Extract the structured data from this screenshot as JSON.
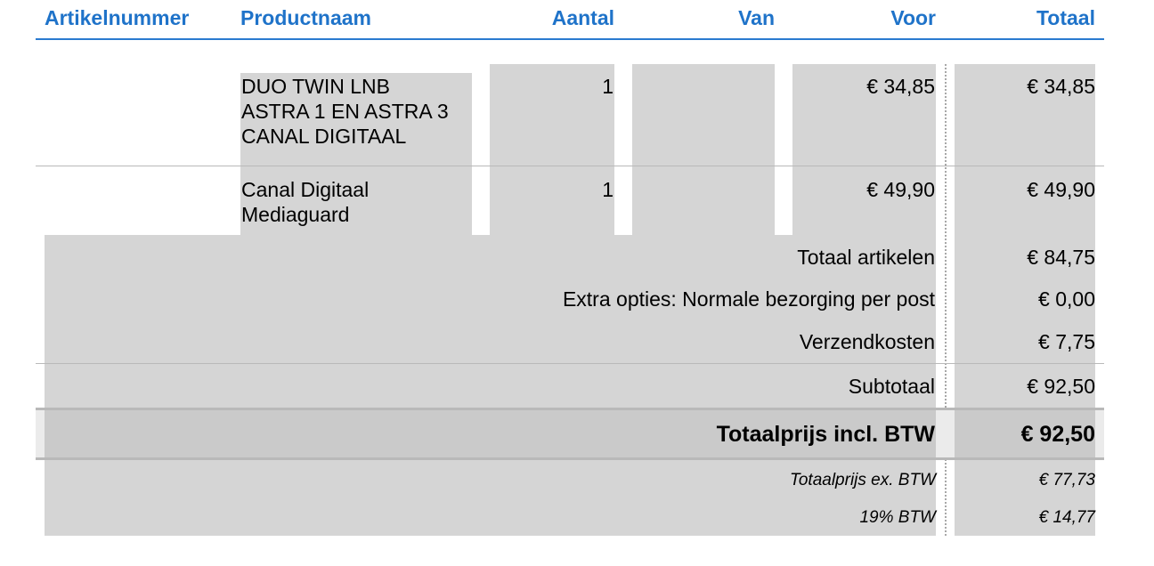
{
  "columns": {
    "sku": "Artikelnummer",
    "name": "Productnaam",
    "qty": "Aantal",
    "from": "Van",
    "price": "Voor",
    "total": "Totaal"
  },
  "items": [
    {
      "name_lines": [
        "DUO TWIN LNB",
        "ASTRA 1 EN ASTRA 3",
        "CANAL DIGITAAL"
      ],
      "qty": "1",
      "from": "",
      "price": "€ 34,85",
      "total": "€ 34,85"
    },
    {
      "name_lines": [
        "Canal Digitaal",
        "Mediaguard"
      ],
      "qty": "1",
      "from": "",
      "price": "€ 49,90",
      "total": "€ 49,90"
    }
  ],
  "summary": {
    "articles_label": "Totaal artikelen",
    "articles_value": "€ 84,75",
    "options_label": "Extra opties: Normale bezorging per post",
    "options_value": "€ 0,00",
    "shipping_label": "Verzendkosten",
    "shipping_value": "€ 7,75",
    "subtotal_label": "Subtotaal",
    "subtotal_value": "€ 92,50",
    "grand_label": "Totaalprijs incl. BTW",
    "grand_value": "€ 92,50",
    "ex_vat_label": "Totaalprijs ex. BTW",
    "ex_vat_value": "€ 77,73",
    "vat_label": "19% BTW",
    "vat_value": "€ 14,77"
  },
  "colors": {
    "header_text": "#1f73c9",
    "cell_background": "#d5d5d5"
  }
}
